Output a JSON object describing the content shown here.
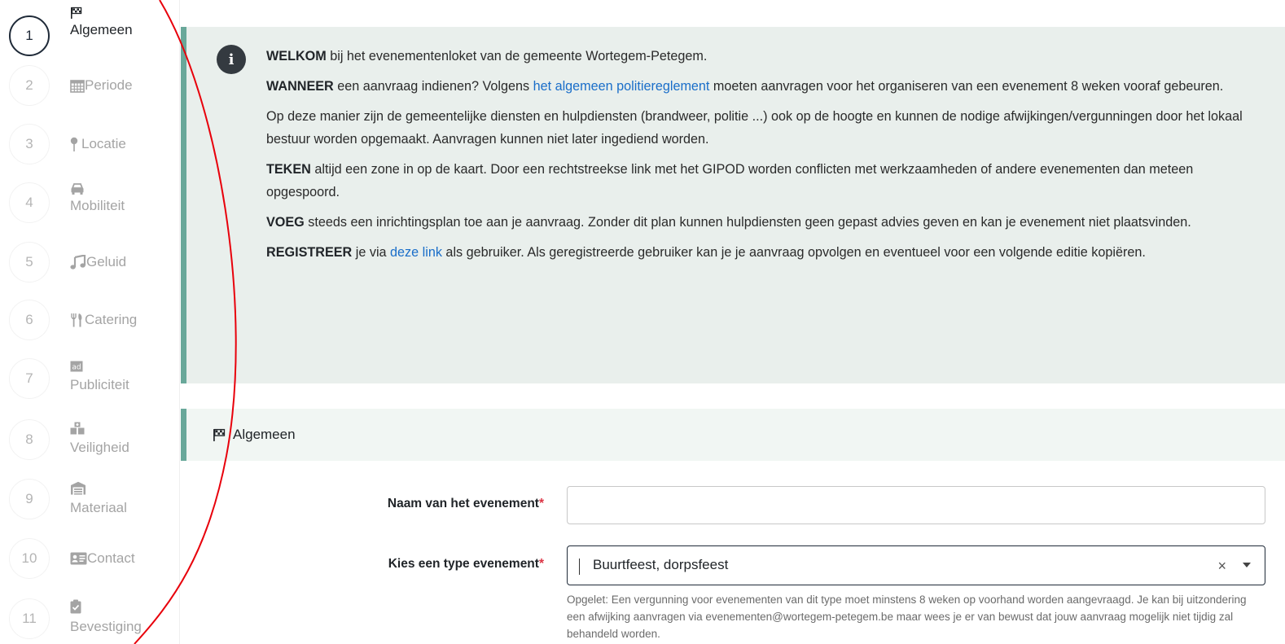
{
  "sidebar": {
    "steps": [
      {
        "number": "1",
        "label": "Algemeen",
        "icon": "flag-icon",
        "active": true
      },
      {
        "number": "2",
        "label": "Periode",
        "icon": "calendar-icon"
      },
      {
        "number": "3",
        "label": "Locatie",
        "icon": "map-pin-icon"
      },
      {
        "number": "4",
        "label": "Mobiliteit",
        "icon": "car-icon"
      },
      {
        "number": "5",
        "label": "Geluid",
        "icon": "music-icon"
      },
      {
        "number": "6",
        "label": "Catering",
        "icon": "utensils-icon"
      },
      {
        "number": "7",
        "label": "Publiciteit",
        "icon": "ad-icon"
      },
      {
        "number": "8",
        "label": "Veiligheid",
        "icon": "first-aid-icon"
      },
      {
        "number": "9",
        "label": "Materiaal",
        "icon": "warehouse-icon"
      },
      {
        "number": "10",
        "label": "Contact",
        "icon": "id-card-icon"
      },
      {
        "number": "11",
        "label": "Bevestiging",
        "icon": "clipboard-check-icon"
      }
    ]
  },
  "info": {
    "p1": {
      "bold": "WELKOM",
      "text": " bij het evenementenloket van de gemeente Wortegem-Petegem."
    },
    "p2": {
      "bold": "WANNEER",
      "text_before": " een aanvraag indienen? Volgens ",
      "link": "het algemeen politiereglement",
      "text_after": " moeten aanvragen voor het organiseren van een evenement 8 weken vooraf gebeuren."
    },
    "p3": {
      "text": "Op deze manier zijn de gemeentelijke diensten en hulpdiensten (brandweer, politie ...) ook op de hoogte en kunnen de nodige afwijkingen/vergunningen door het lokaal bestuur worden opgemaakt. Aanvragen kunnen niet later ingediend worden."
    },
    "p4": {
      "bold": "TEKEN",
      "text": " altijd een zone in op de kaart. Door een rechtstreekse link met het GIPOD worden conflicten met werkzaamheden of andere evenementen dan meteen opgespoord."
    },
    "p5": {
      "bold": "VOEG",
      "text": " steeds een inrichtingsplan toe aan je aanvraag. Zonder dit plan kunnen hulpdiensten geen gepast advies geven en kan je evenement niet plaatsvinden."
    },
    "p6": {
      "bold": "REGISTREER",
      "text_before": " je via ",
      "link": "deze link",
      "text_after": " als gebruiker. Als geregistreerde gebruiker kan je je aanvraag opvolgen en eventueel voor een volgende editie kopiëren."
    }
  },
  "section": {
    "title": "Algemeen"
  },
  "form": {
    "name_label": "Naam van het evenement",
    "name_value": "",
    "type_label": "Kies een type evenement",
    "required_mark": "*",
    "type_value": "Buurtfeest, dorpsfeest",
    "clear_symbol": "×",
    "help_text": "Opgelet: Een vergunning voor evenementen van dit type moet minstens 8 weken op voorhand worden aangevraagd. Je kan bij uitzondering een afwijking aanvragen via evenementen@wortegem-petegem.be maar wees je er van bewust dat jouw aanvraag mogelijk niet tijdig zal behandeld worden."
  },
  "colors": {
    "accent": "#69a89a",
    "link": "#1a6ec9",
    "required": "#dc3545",
    "annotation": "#e8000b"
  }
}
